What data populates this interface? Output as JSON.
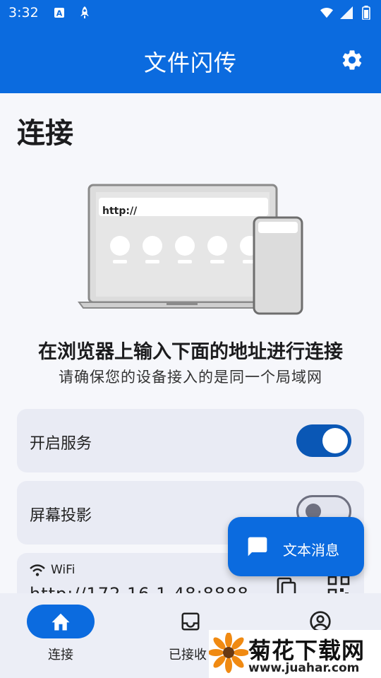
{
  "status_bar": {
    "time": "3:32",
    "icons": [
      "translate-icon",
      "rocket-icon",
      "wifi-icon",
      "signal-icon",
      "battery-icon"
    ]
  },
  "app_bar": {
    "title": "文件闪传",
    "settings_icon": "gear-icon"
  },
  "page": {
    "title": "连接",
    "illustration": {
      "url_text": "http://"
    },
    "headline": "在浏览器上输入下面的地址进行连接",
    "subline": "请确保您的设备接入的是同一个局域网"
  },
  "settings": {
    "service": {
      "label": "开启服务",
      "enabled": true
    },
    "screen_cast": {
      "label": "屏幕投影",
      "enabled": false
    }
  },
  "connection": {
    "network_name": "WiFi",
    "address": "http://172.16.1.48:8888",
    "copy_icon": "copy-icon",
    "qr_icon": "qr-code-icon"
  },
  "fab": {
    "label": "文本消息",
    "icon": "message-icon"
  },
  "bottom_nav": {
    "items": [
      {
        "label": "连接",
        "icon": "home-icon",
        "active": true
      },
      {
        "label": "已接收",
        "icon": "inbox-icon",
        "active": false
      },
      {
        "label": "",
        "icon": "account-icon",
        "active": false
      }
    ]
  },
  "watermark": {
    "text": "菊花下载网",
    "url": "www.juahar.com"
  },
  "colors": {
    "primary": "#0b6bdf",
    "toggle_on": "#0a57b5",
    "card": "#e9ebf4",
    "background": "#f6f7fb"
  }
}
